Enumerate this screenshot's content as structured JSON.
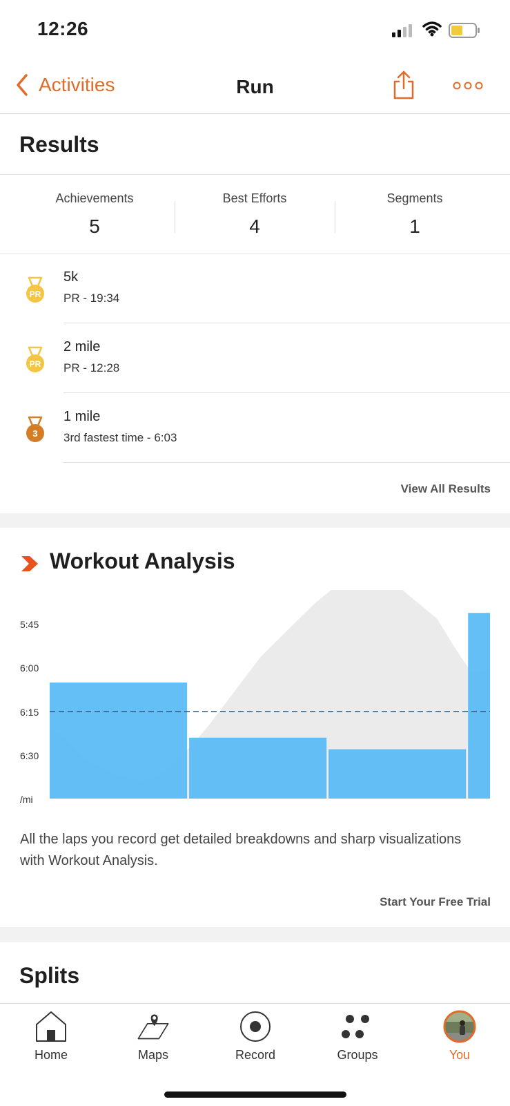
{
  "status_bar": {
    "time": "12:26"
  },
  "nav": {
    "back_label": "Activities",
    "title": "Run",
    "share_icon": "share-icon",
    "more_icon": "more-icon"
  },
  "colors": {
    "accent": "#e06c2a",
    "lap_bar": "#5bbcf5",
    "gold": "#f4c542",
    "bronze": "#d47d27"
  },
  "results": {
    "title": "Results",
    "stats": [
      {
        "label": "Achievements",
        "value": "5"
      },
      {
        "label": "Best Efforts",
        "value": "4"
      },
      {
        "label": "Segments",
        "value": "1"
      }
    ],
    "items": [
      {
        "icon": "pr-medal-icon",
        "title": "5k",
        "subtitle": "PR - 19:34"
      },
      {
        "icon": "pr-medal-icon",
        "title": "2 mile",
        "subtitle": "PR - 12:28"
      },
      {
        "icon": "third-place-medal-icon",
        "title": "1 mile",
        "subtitle": "3rd fastest time - 6:03"
      }
    ],
    "view_all": "View All Results"
  },
  "workout_analysis": {
    "title": "Workout Analysis",
    "description": "All the laps you record get detailed breakdowns and sharp visualizations with Workout Analysis.",
    "cta": "Start Your Free Trial"
  },
  "chart_data": {
    "type": "bar",
    "y_tick_labels": [
      "5:45",
      "6:00",
      "6:15",
      "6:30",
      "/mi"
    ],
    "y_tick_values_sec": [
      345,
      360,
      375,
      390
    ],
    "y_axis_inverted": true,
    "laps": [
      {
        "pace_sec": 365
      },
      {
        "pace_sec": 384
      },
      {
        "pace_sec": 388
      },
      {
        "pace_sec": 341
      }
    ],
    "lap_widths_relative": [
      1.0,
      1.0,
      1.0,
      0.16
    ],
    "average_pace_sec": 375,
    "background_profile_pace_sec": [
      380,
      385,
      391,
      395,
      397,
      399,
      398,
      393,
      387,
      380,
      372,
      364,
      356,
      350,
      344,
      338,
      333,
      330,
      329,
      330,
      333,
      338,
      343,
      353,
      362,
      360
    ],
    "grid": false
  },
  "splits": {
    "title": "Splits"
  },
  "tabbar": {
    "items": [
      {
        "label": "Home",
        "icon": "home-icon"
      },
      {
        "label": "Maps",
        "icon": "map-icon"
      },
      {
        "label": "Record",
        "icon": "record-icon"
      },
      {
        "label": "Groups",
        "icon": "groups-icon"
      },
      {
        "label": "You",
        "icon": "avatar-icon"
      }
    ]
  }
}
